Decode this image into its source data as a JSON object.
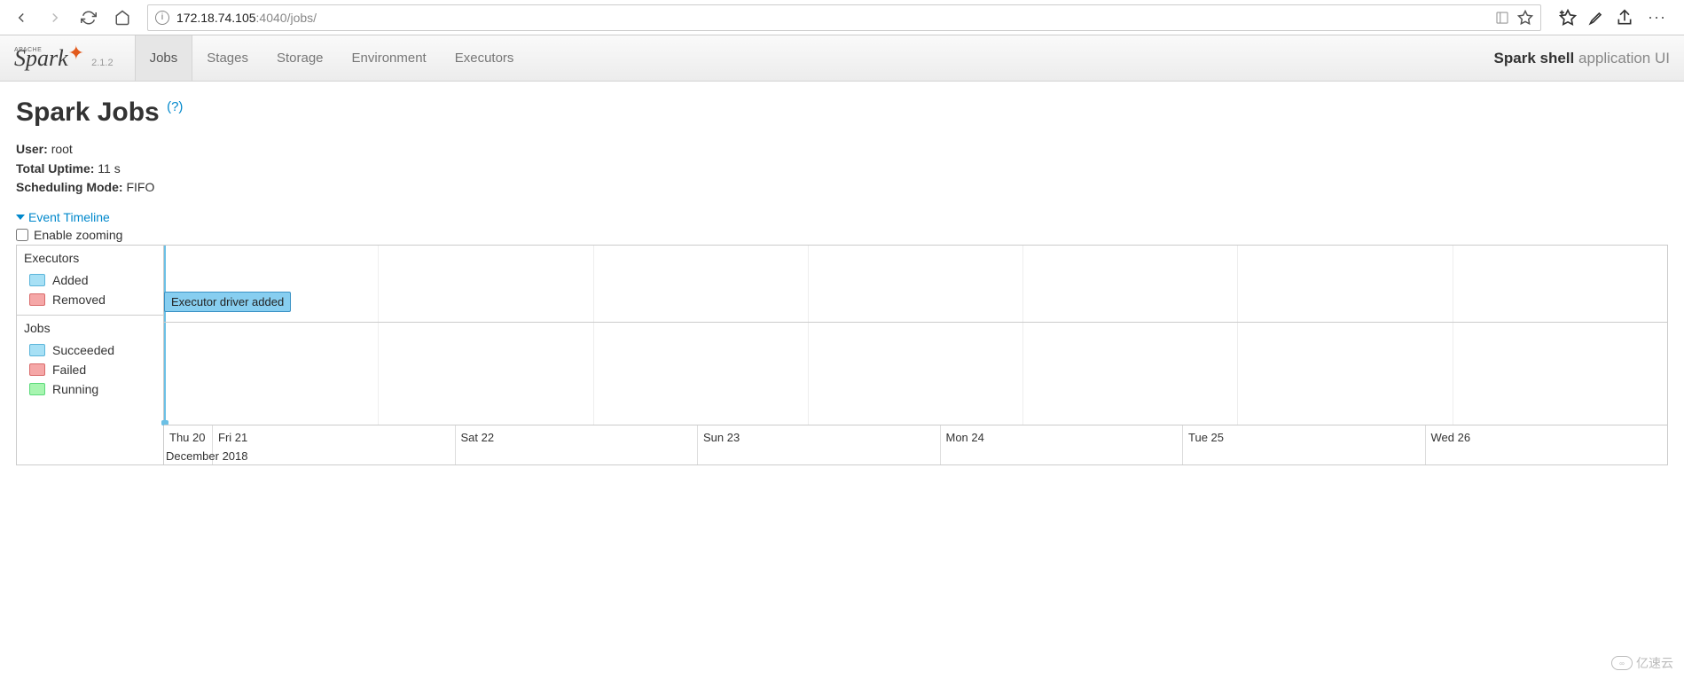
{
  "browser": {
    "url_host": "172.18.74.105",
    "url_rest": ":4040/jobs/"
  },
  "navbar": {
    "version": "2.1.2",
    "tabs": [
      "Jobs",
      "Stages",
      "Storage",
      "Environment",
      "Executors"
    ],
    "app_name": "Spark shell",
    "app_suffix": "application UI"
  },
  "page": {
    "title": "Spark Jobs",
    "help": "(?)",
    "meta": {
      "user_label": "User:",
      "user_value": "root",
      "uptime_label": "Total Uptime:",
      "uptime_value": "11 s",
      "sched_label": "Scheduling Mode:",
      "sched_value": "FIFO"
    },
    "timeline_toggle": "Event Timeline",
    "zoom_label": "Enable zooming"
  },
  "timeline": {
    "group_executors": "Executors",
    "legend_added": "Added",
    "legend_removed": "Removed",
    "group_jobs": "Jobs",
    "legend_succeeded": "Succeeded",
    "legend_failed": "Failed",
    "legend_running": "Running",
    "event_label": "Executor driver added",
    "axis": [
      "Thu 20",
      "Fri 21",
      "Sat 22",
      "Sun 23",
      "Mon 24",
      "Tue 25",
      "Wed 26"
    ],
    "axis_month": "December 2018"
  },
  "watermark": "亿速云"
}
